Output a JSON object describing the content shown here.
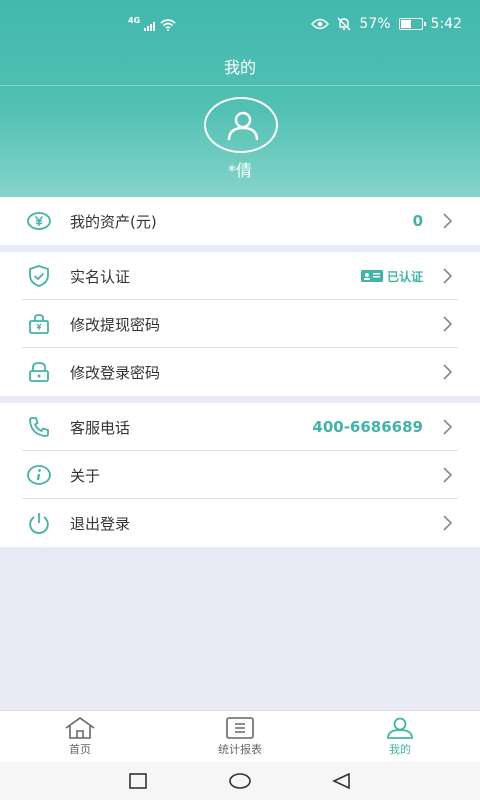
{
  "status_bar": {
    "network": "4G",
    "battery": "57%",
    "battery_level": 0.57,
    "time": "5:42"
  },
  "header": {
    "title": "我的",
    "username": "*倩"
  },
  "asset_row": {
    "label": "我的资产(元)",
    "value": "0"
  },
  "security_rows": [
    {
      "label": "实名认证",
      "status": "已认证"
    },
    {
      "label": "修改提现密码"
    },
    {
      "label": "修改登录密码"
    }
  ],
  "support_rows": [
    {
      "label": "客服电话",
      "value": "400-6686689"
    },
    {
      "label": "关于"
    },
    {
      "label": "退出登录"
    }
  ],
  "tabbar": {
    "tabs": [
      {
        "label": "首页"
      },
      {
        "label": "统计报表"
      },
      {
        "label": "我的"
      }
    ],
    "active": "我的"
  },
  "colors": {
    "accent": "#43b3a8",
    "header_top": "#43b8ad",
    "background": "#e8eaf5"
  }
}
